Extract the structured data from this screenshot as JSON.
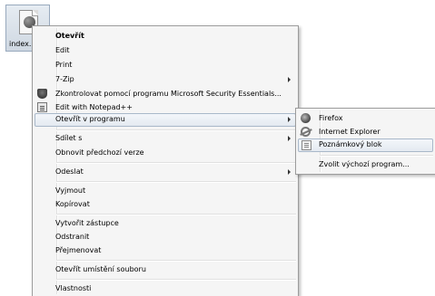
{
  "desktop": {
    "file_label": "index."
  },
  "context_menu": {
    "items": [
      {
        "label": "Otevřít"
      },
      {
        "label": "Edit"
      },
      {
        "label": "Print"
      },
      {
        "label": "7-Zip"
      },
      {
        "label": "Zkontrolovat pomocí programu Microsoft Security Essentials..."
      },
      {
        "label": "Edit with Notepad++"
      },
      {
        "label": "Otevřít v programu"
      },
      {
        "label": "Sdílet s"
      },
      {
        "label": "Obnovit předchozí verze"
      },
      {
        "label": "Odeslat"
      },
      {
        "label": "Vyjmout"
      },
      {
        "label": "Kopírovat"
      },
      {
        "label": "Vytvořit zástupce"
      },
      {
        "label": "Odstranit"
      },
      {
        "label": "Přejmenovat"
      },
      {
        "label": "Otevřít umístění souboru"
      },
      {
        "label": "Vlastnosti"
      }
    ]
  },
  "submenu": {
    "items": [
      {
        "label": "Firefox"
      },
      {
        "label": "Internet Explorer"
      },
      {
        "label": "Poznámkový blok"
      },
      {
        "label": "Zvolit výchozí program..."
      }
    ]
  },
  "icons": {
    "security_essentials": "security-essentials-icon",
    "notepadpp": "notepadpp-icon",
    "firefox": "firefox-icon",
    "internet_explorer": "internet-explorer-icon",
    "notepad": "notepad-icon"
  }
}
